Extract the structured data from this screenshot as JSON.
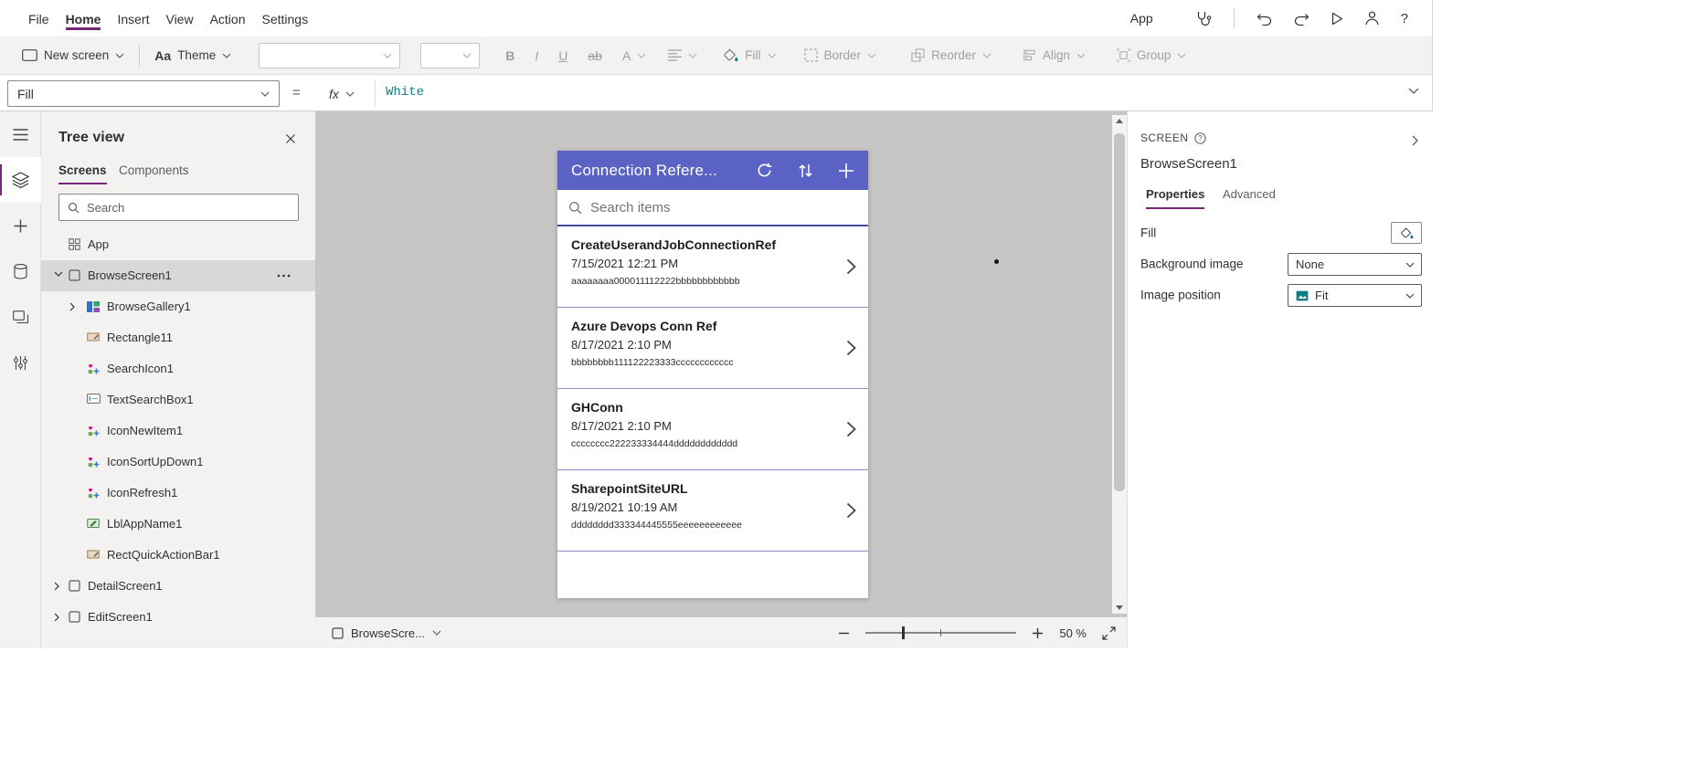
{
  "colors": {
    "brand_purple": "#742774",
    "app_accent": "#5a62c4",
    "app_divider": "#8b90cc",
    "app_search_underline": "#434a9d",
    "formula_teal": "#117d87",
    "canvas_gray": "#c8c6c4",
    "panel_gray": "#f3f2f1"
  },
  "menu": {
    "items": [
      "File",
      "Home",
      "Insert",
      "View",
      "Action",
      "Settings"
    ],
    "app_label": "App",
    "help": "?"
  },
  "ribbon": {
    "new_screen_label": "New screen",
    "theme_icon": "Aa",
    "theme_label": "Theme",
    "bold": "B",
    "italic": "I",
    "underline": "U",
    "strikethrough": "ab",
    "font_color": "A",
    "fill_label": "Fill",
    "border_label": "Border",
    "reorder_label": "Reorder",
    "align_label": "Align",
    "group_label": "Group"
  },
  "formula_bar": {
    "property": "Fill",
    "equals_sign": "=",
    "fx_label": "fx",
    "formula": "White"
  },
  "tree_view": {
    "title": "Tree view",
    "tab_screens": "Screens",
    "tab_components": "Components",
    "search_placeholder": "Search",
    "items": [
      {
        "label": "App"
      },
      {
        "label": "BrowseScreen1"
      },
      {
        "label": "BrowseGallery1"
      },
      {
        "label": "Rectangle11"
      },
      {
        "label": "SearchIcon1"
      },
      {
        "label": "TextSearchBox1"
      },
      {
        "label": "IconNewItem1"
      },
      {
        "label": "IconSortUpDown1"
      },
      {
        "label": "IconRefresh1"
      },
      {
        "label": "LblAppName1"
      },
      {
        "label": "RectQuickActionBar1"
      },
      {
        "label": "DetailScreen1"
      },
      {
        "label": "EditScreen1"
      }
    ]
  },
  "canvas": {
    "app": {
      "title": "Connection Refere...",
      "search_placeholder": "Search items",
      "items": [
        {
          "title": "CreateUserandJobConnectionRef",
          "date": "7/15/2021 12:21 PM",
          "code": "aaaaaaaa000011112222bbbbbbbbbbbb"
        },
        {
          "title": "Azure Devops Conn Ref",
          "date": "8/17/2021 2:10 PM",
          "code": "bbbbbbbb111122223333cccccccccccc"
        },
        {
          "title": "GHConn",
          "date": "8/17/2021 2:10 PM",
          "code": "cccccccc222233334444dddddddddddd"
        },
        {
          "title": "SharepointSiteURL",
          "date": "8/19/2021 10:19 AM",
          "code": "dddddddd333344445555eeeeeeeeeeee"
        }
      ]
    }
  },
  "properties_panel": {
    "header": "SCREEN",
    "object_name": "BrowseScreen1",
    "tab_properties": "Properties",
    "tab_advanced": "Advanced",
    "fill_label": "Fill",
    "background_image_label": "Background image",
    "background_image_value": "None",
    "image_position_label": "Image position",
    "image_position_value": "Fit"
  },
  "status_bar": {
    "screen_selector": "BrowseScre...",
    "zoom_label": "50 %"
  }
}
